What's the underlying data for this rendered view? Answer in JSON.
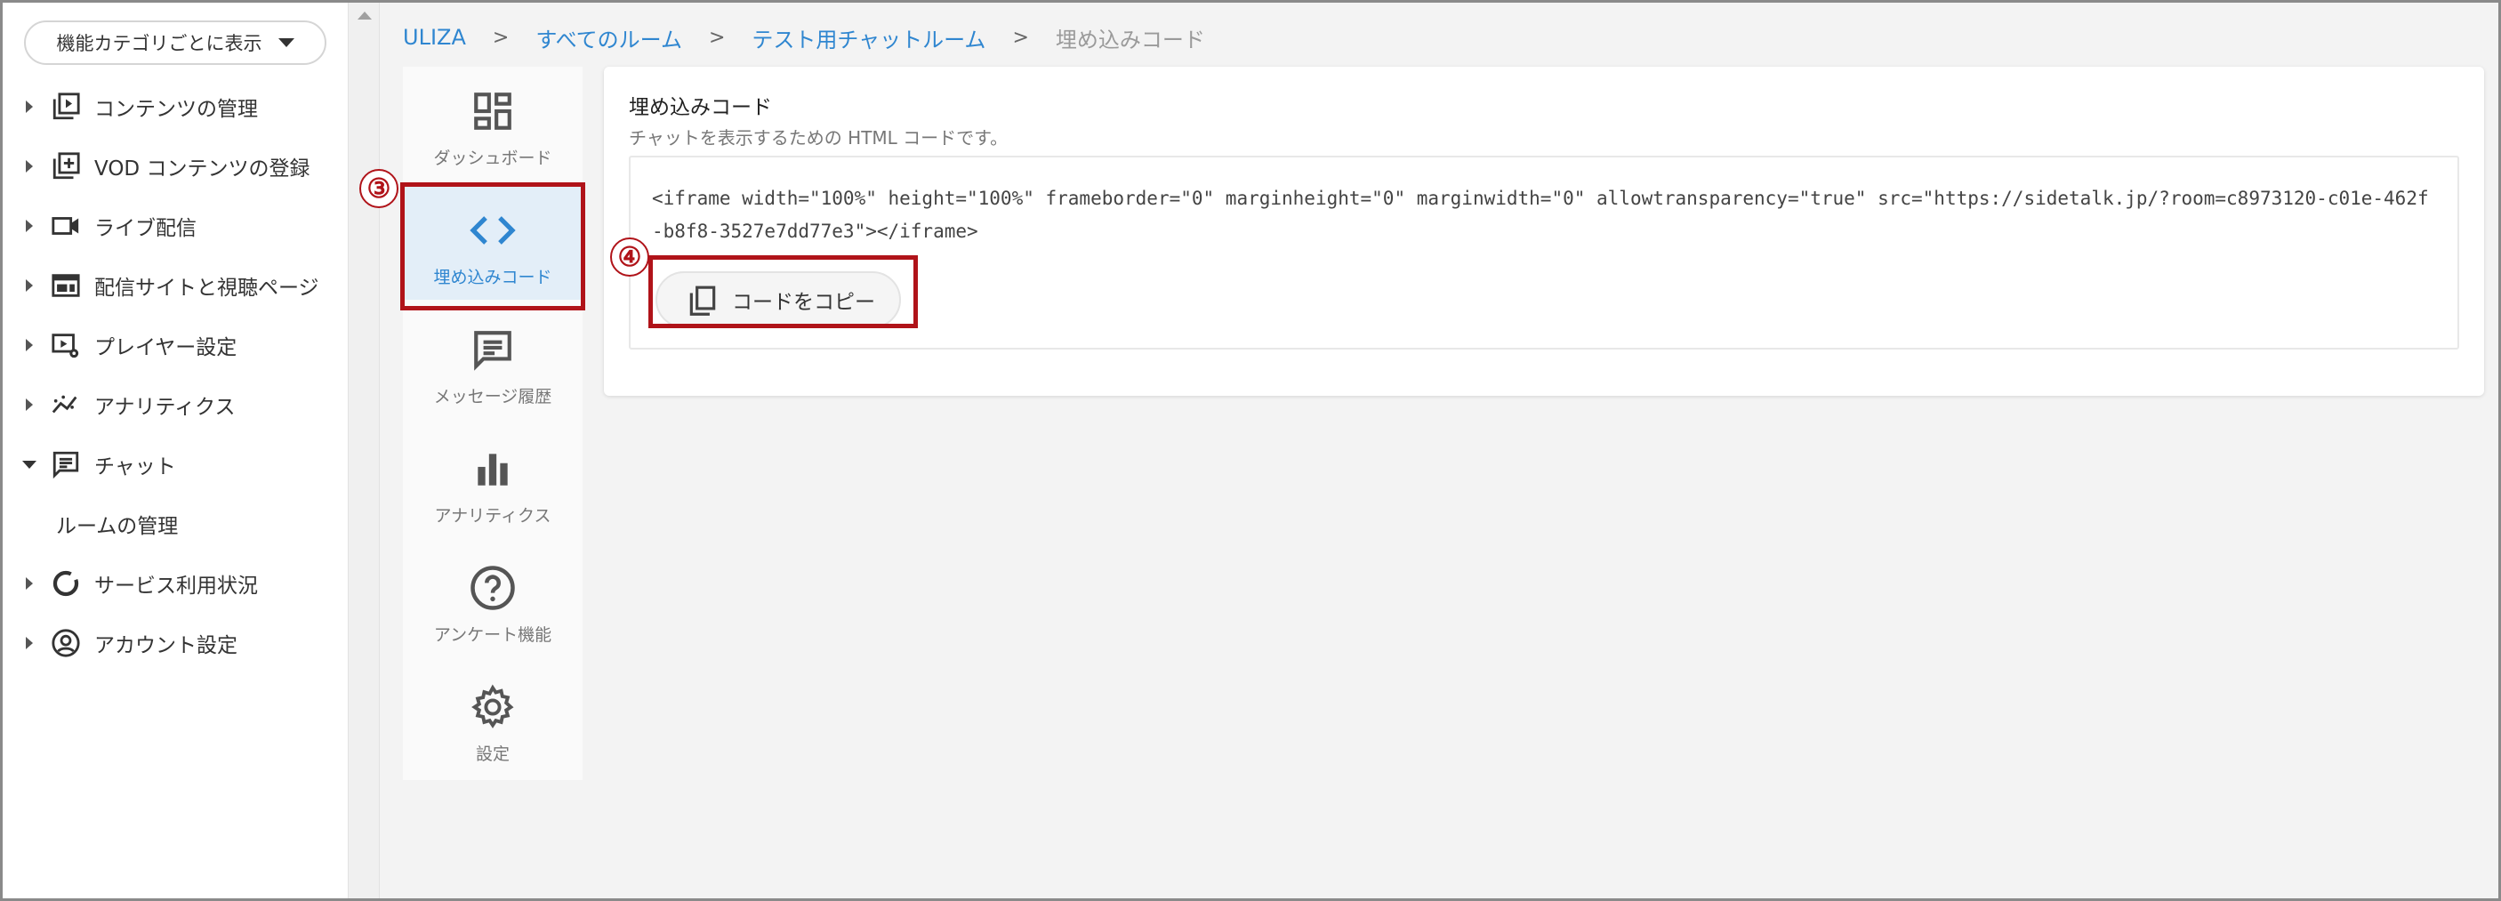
{
  "sidebar": {
    "category_button": "機能カテゴリごとに表示",
    "items": [
      {
        "label": "コンテンツの管理",
        "icon": "play-library-icon"
      },
      {
        "label": "VOD コンテンツの登録",
        "icon": "add-library-icon"
      },
      {
        "label": "ライブ配信",
        "icon": "videocam-icon"
      },
      {
        "label": "配信サイトと視聴ページ",
        "icon": "web-page-icon"
      },
      {
        "label": "プレイヤー設定",
        "icon": "player-settings-icon"
      },
      {
        "label": "アナリティクス",
        "icon": "analytics-icon"
      },
      {
        "label": "チャット",
        "icon": "chat-icon"
      },
      {
        "label": "サービス利用状況",
        "icon": "donut-chart-icon"
      },
      {
        "label": "アカウント設定",
        "icon": "account-circle-icon"
      }
    ],
    "chat_subitem": "ルームの管理"
  },
  "breadcrumb": {
    "items": [
      "ULIZA",
      "すべてのルーム",
      "テスト用チャットルーム"
    ],
    "current": "埋め込みコード",
    "separator": ">"
  },
  "subnav": {
    "items": [
      {
        "label": "ダッシュボード",
        "icon": "dashboard-icon"
      },
      {
        "label": "埋め込みコード",
        "icon": "code-icon"
      },
      {
        "label": "メッセージ履歴",
        "icon": "message-icon"
      },
      {
        "label": "アナリティクス",
        "icon": "bar-chart-icon"
      },
      {
        "label": "アンケート機能",
        "icon": "help-circle-icon"
      },
      {
        "label": "設定",
        "icon": "gear-icon"
      }
    ],
    "active_label": "埋め込みコード"
  },
  "embed": {
    "title": "埋め込みコード",
    "description": "チャットを表示するための HTML コードです。",
    "code": "<iframe width=\"100%\" height=\"100%\" frameborder=\"0\" marginheight=\"0\" marginwidth=\"0\" allowtransparency=\"true\" src=\"https://sidetalk.jp/?room=c8973120-c01e-462f-b8f8-3527e7dd77e3\"></iframe>",
    "copy_button": "コードをコピー"
  },
  "annotations": {
    "step3": "③",
    "step4": "④",
    "color": "#b01319"
  },
  "colors": {
    "link": "#2f86d0",
    "active_bg": "#e3eef8"
  }
}
